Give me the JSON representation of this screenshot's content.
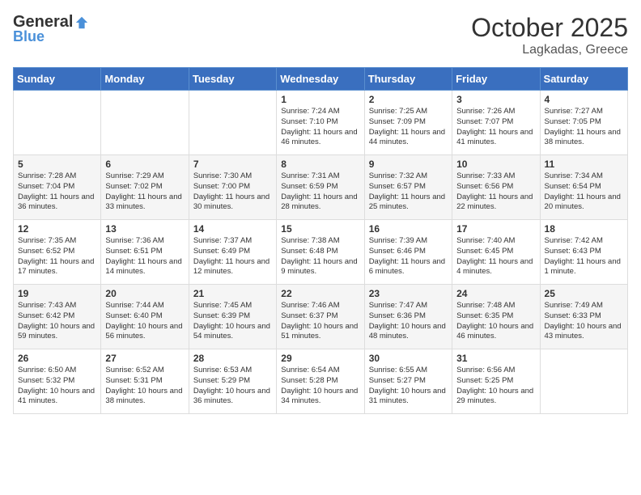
{
  "header": {
    "logo": {
      "general": "General",
      "blue": "Blue"
    },
    "title": "October 2025",
    "subtitle": "Lagkadas, Greece"
  },
  "weekdays": [
    "Sunday",
    "Monday",
    "Tuesday",
    "Wednesday",
    "Thursday",
    "Friday",
    "Saturday"
  ],
  "weeks": [
    [
      null,
      null,
      null,
      {
        "day": 1,
        "sunrise": "7:24 AM",
        "sunset": "7:10 PM",
        "daylight": "11 hours and 46 minutes."
      },
      {
        "day": 2,
        "sunrise": "7:25 AM",
        "sunset": "7:09 PM",
        "daylight": "11 hours and 44 minutes."
      },
      {
        "day": 3,
        "sunrise": "7:26 AM",
        "sunset": "7:07 PM",
        "daylight": "11 hours and 41 minutes."
      },
      {
        "day": 4,
        "sunrise": "7:27 AM",
        "sunset": "7:05 PM",
        "daylight": "11 hours and 38 minutes."
      }
    ],
    [
      {
        "day": 5,
        "sunrise": "7:28 AM",
        "sunset": "7:04 PM",
        "daylight": "11 hours and 36 minutes."
      },
      {
        "day": 6,
        "sunrise": "7:29 AM",
        "sunset": "7:02 PM",
        "daylight": "11 hours and 33 minutes."
      },
      {
        "day": 7,
        "sunrise": "7:30 AM",
        "sunset": "7:00 PM",
        "daylight": "11 hours and 30 minutes."
      },
      {
        "day": 8,
        "sunrise": "7:31 AM",
        "sunset": "6:59 PM",
        "daylight": "11 hours and 28 minutes."
      },
      {
        "day": 9,
        "sunrise": "7:32 AM",
        "sunset": "6:57 PM",
        "daylight": "11 hours and 25 minutes."
      },
      {
        "day": 10,
        "sunrise": "7:33 AM",
        "sunset": "6:56 PM",
        "daylight": "11 hours and 22 minutes."
      },
      {
        "day": 11,
        "sunrise": "7:34 AM",
        "sunset": "6:54 PM",
        "daylight": "11 hours and 20 minutes."
      }
    ],
    [
      {
        "day": 12,
        "sunrise": "7:35 AM",
        "sunset": "6:52 PM",
        "daylight": "11 hours and 17 minutes."
      },
      {
        "day": 13,
        "sunrise": "7:36 AM",
        "sunset": "6:51 PM",
        "daylight": "11 hours and 14 minutes."
      },
      {
        "day": 14,
        "sunrise": "7:37 AM",
        "sunset": "6:49 PM",
        "daylight": "11 hours and 12 minutes."
      },
      {
        "day": 15,
        "sunrise": "7:38 AM",
        "sunset": "6:48 PM",
        "daylight": "11 hours and 9 minutes."
      },
      {
        "day": 16,
        "sunrise": "7:39 AM",
        "sunset": "6:46 PM",
        "daylight": "11 hours and 6 minutes."
      },
      {
        "day": 17,
        "sunrise": "7:40 AM",
        "sunset": "6:45 PM",
        "daylight": "11 hours and 4 minutes."
      },
      {
        "day": 18,
        "sunrise": "7:42 AM",
        "sunset": "6:43 PM",
        "daylight": "11 hours and 1 minute."
      }
    ],
    [
      {
        "day": 19,
        "sunrise": "7:43 AM",
        "sunset": "6:42 PM",
        "daylight": "10 hours and 59 minutes."
      },
      {
        "day": 20,
        "sunrise": "7:44 AM",
        "sunset": "6:40 PM",
        "daylight": "10 hours and 56 minutes."
      },
      {
        "day": 21,
        "sunrise": "7:45 AM",
        "sunset": "6:39 PM",
        "daylight": "10 hours and 54 minutes."
      },
      {
        "day": 22,
        "sunrise": "7:46 AM",
        "sunset": "6:37 PM",
        "daylight": "10 hours and 51 minutes."
      },
      {
        "day": 23,
        "sunrise": "7:47 AM",
        "sunset": "6:36 PM",
        "daylight": "10 hours and 48 minutes."
      },
      {
        "day": 24,
        "sunrise": "7:48 AM",
        "sunset": "6:35 PM",
        "daylight": "10 hours and 46 minutes."
      },
      {
        "day": 25,
        "sunrise": "7:49 AM",
        "sunset": "6:33 PM",
        "daylight": "10 hours and 43 minutes."
      }
    ],
    [
      {
        "day": 26,
        "sunrise": "6:50 AM",
        "sunset": "5:32 PM",
        "daylight": "10 hours and 41 minutes."
      },
      {
        "day": 27,
        "sunrise": "6:52 AM",
        "sunset": "5:31 PM",
        "daylight": "10 hours and 38 minutes."
      },
      {
        "day": 28,
        "sunrise": "6:53 AM",
        "sunset": "5:29 PM",
        "daylight": "10 hours and 36 minutes."
      },
      {
        "day": 29,
        "sunrise": "6:54 AM",
        "sunset": "5:28 PM",
        "daylight": "10 hours and 34 minutes."
      },
      {
        "day": 30,
        "sunrise": "6:55 AM",
        "sunset": "5:27 PM",
        "daylight": "10 hours and 31 minutes."
      },
      {
        "day": 31,
        "sunrise": "6:56 AM",
        "sunset": "5:25 PM",
        "daylight": "10 hours and 29 minutes."
      },
      null
    ]
  ],
  "labels": {
    "sunrise": "Sunrise:",
    "sunset": "Sunset:",
    "daylight": "Daylight:"
  }
}
